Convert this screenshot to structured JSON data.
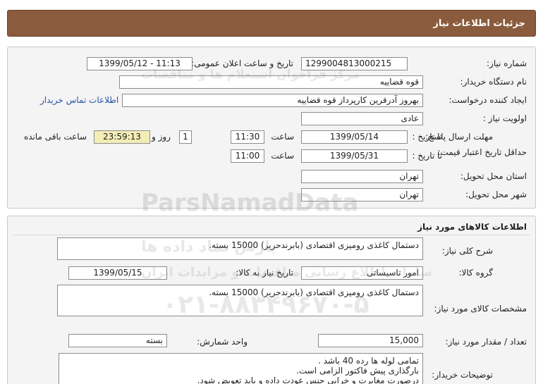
{
  "header": {
    "title": "جزئیات اطلاعات نیاز"
  },
  "need_info": {
    "need_number_label": "شماره نیاز:",
    "need_number": "1299004813000215",
    "announce_label": "تاریخ و ساعت اعلان عمومی:",
    "announce_value": "1399/05/12 - 11:13",
    "buyer_org_label": "نام دستگاه خریدار:",
    "buyer_org": "قوه قضاییه",
    "creator_label": "ایجاد کننده درخواست:",
    "creator": "بهروز آدرقرین کارپرداز قوه قضاییه",
    "contact_link": "اطلاعات تماس خریدار",
    "priority_label": "اولویت نیاز :",
    "priority": "عادی",
    "deadline_label": "مهلت ارسال پاسخ:",
    "to_date_label": "تا تاریخ :",
    "deadline_date": "1399/05/14",
    "time_label": "ساعت",
    "deadline_time": "11:30",
    "days": "1",
    "day_and_label": "روز و",
    "remaining_time": "23:59:13",
    "remaining_label": "ساعت باقی مانده",
    "validity_label": "حداقل تاریخ اعتبار قیمت:",
    "validity_to_label": "تا تاریخ :",
    "validity_date": "1399/05/31",
    "validity_time_label": "ساعت",
    "validity_time": "11:00",
    "province_label": "استان محل تحویل:",
    "province": "تهران",
    "city_label": "شهر محل تحویل:",
    "city": "تهران"
  },
  "goods": {
    "section_title": "اطلاعات کالاهای مورد نیاز",
    "summary_label": "شرح کلی نیاز:",
    "summary": "دستمال کاغذی رومیزی اقتصادی (بابرندحریر) 15000 بسته.",
    "group_label": "گروه کالا:",
    "group": "امور تاسیساتی",
    "need_date_label": "تاریخ نیاز به کالا:",
    "need_date": "1399/05/15",
    "specs_label": "مشخصات کالای مورد نیاز:",
    "specs": "دستمال کاغذی رومیزی اقتصادی (بابرندحریر) 15000 بسته.",
    "qty_label": "تعداد / مقدار مورد نیاز:",
    "qty": "15,000",
    "unit_label": "واحد شمارش:",
    "unit": "بسته",
    "buyer_notes_label": "توضیحات خریدار:",
    "buyer_notes": [
      "تمامی لوله ها رده 40 باشد .",
      "بارگذاری پیش فاکتور الزامی است.",
      "درصورت مغایرت و خرابی جنس  عودت داده و باید تعویض شود."
    ]
  },
  "watermark": {
    "brand": "ParsNamadData",
    "line1": "مرکز فراخوان استعلام ها و مناقصات",
    "line2": "سامانه اطلاع رسانی مناقصات و مزایدات ایران",
    "phone": "۰۲۱-۸۸۳۴۹۶۷۰-۵",
    "sub": "پارس نماد داده ها"
  }
}
